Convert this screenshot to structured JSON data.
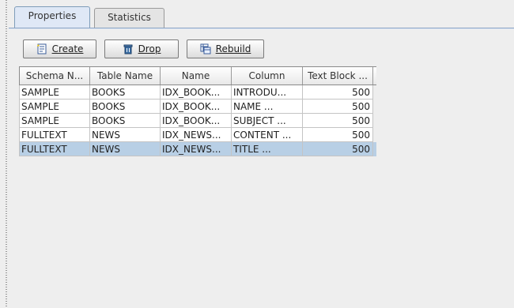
{
  "tabs": [
    {
      "label": "Properties",
      "active": true
    },
    {
      "label": "Statistics",
      "active": false
    }
  ],
  "toolbar": {
    "create_label": "Create",
    "drop_label": "Drop",
    "rebuild_label": "Rebuild"
  },
  "table": {
    "columns": [
      "Schema N...",
      "Table Name",
      "Name",
      "Column",
      "Text Block ..."
    ],
    "rows": [
      [
        "SAMPLE",
        "BOOKS",
        "IDX_BOOK...",
        "INTRODU...",
        "500"
      ],
      [
        "SAMPLE",
        "BOOKS",
        "IDX_BOOK...",
        "NAME      ...",
        "500"
      ],
      [
        "SAMPLE",
        "BOOKS",
        "IDX_BOOK...",
        "SUBJECT  ...",
        "500"
      ],
      [
        "FULLTEXT",
        "NEWS",
        "IDX_NEWS...",
        "CONTENT ...",
        "500"
      ],
      [
        "FULLTEXT",
        "NEWS",
        "IDX_NEWS...",
        "TITLE     ...",
        "500"
      ]
    ],
    "selected_row": 4
  }
}
